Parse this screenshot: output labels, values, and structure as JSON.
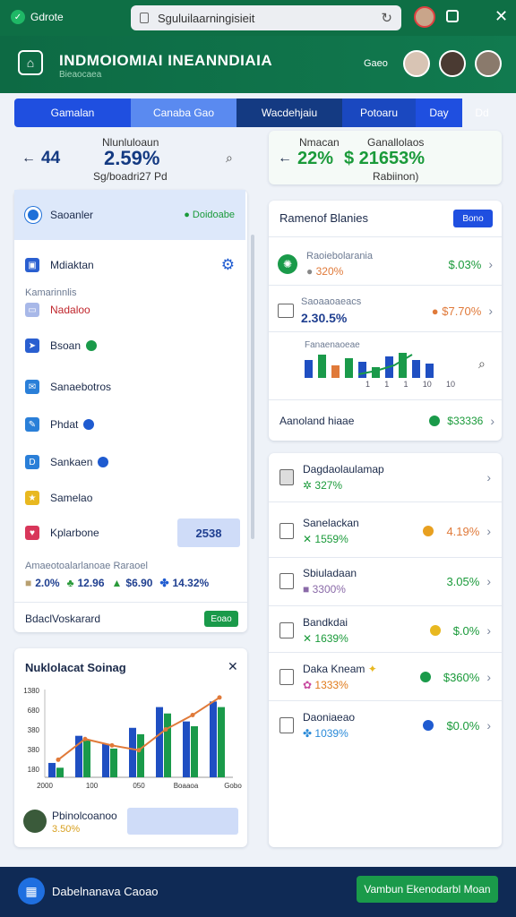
{
  "browser": {
    "tab_label": "Gdrote",
    "url": "Sguluilaarningisieit",
    "reload_icon": "reload-icon",
    "extension_icon": "extension-icon",
    "close_icon": "close-icon"
  },
  "header": {
    "title": "INDMOIOMIAI INEANNDIAIA",
    "subtitle": "Bieaocaea",
    "user_name": "Gaeo"
  },
  "tabs": [
    {
      "label": "Gamalan"
    },
    {
      "label": "Canaba Gao"
    },
    {
      "label": "Wacdehjaiu"
    },
    {
      "label": "Potoaru"
    },
    {
      "label": "Day"
    },
    {
      "label": "Dd"
    }
  ],
  "left_summary": {
    "label": "Nlunluloaun",
    "count": "44",
    "value": "2.59%",
    "sub": "Sg/boadri27 Pd"
  },
  "right_summary": {
    "label1": "Nmacan",
    "label2": "Ganallolaos",
    "value1": "22%",
    "value2": "$ 21653%",
    "sub": "Rabiinon)"
  },
  "sidebar": {
    "items": [
      {
        "label": "Saoanler",
        "badge": "Doidoabe"
      },
      {
        "label": "Mdiaktan"
      },
      {
        "label": "Nadaloo",
        "section": "Kamarinnlis"
      },
      {
        "label": "Bsoan"
      },
      {
        "label": "Sanaebotros"
      },
      {
        "label": "Phdat"
      },
      {
        "label": "Sankaen"
      },
      {
        "label": "Samelao"
      },
      {
        "label": "Kplarbone",
        "value": "2538"
      }
    ],
    "stats_header": "Amaeotoalarlanoae Raraoel",
    "stats": [
      "2.0%",
      "12.96",
      "$6.90",
      "14.32%"
    ],
    "footer_label": "BdaclVoskarard",
    "footer_button": "Eoao"
  },
  "chart_card": {
    "title": "Nuklolacat Soinag",
    "y_ticks": [
      "1380",
      "680",
      "380",
      "380",
      "180"
    ],
    "x_ticks": [
      "2000",
      "100",
      "050",
      "Boaaoa",
      "Gobo"
    ],
    "user_name": "Pbinolcoanoo",
    "user_value": "3.50%"
  },
  "chart_data": {
    "type": "bar",
    "x": [
      "2000",
      "100",
      "050",
      "Boaaoa",
      "Gobo"
    ],
    "ylabels": [
      "1380",
      "680",
      "380",
      "380",
      "180"
    ],
    "series": [
      {
        "values": [
          18,
          52,
          42,
          62,
          88,
          70,
          95
        ]
      },
      {
        "values": [
          12,
          46,
          36,
          54,
          80,
          64,
          88
        ]
      },
      {
        "values": [
          22,
          48,
          40,
          34,
          60,
          78,
          100
        ]
      }
    ],
    "series_colors": [
      "#1f4fc2",
      "#1a9a4a",
      "#e07a3a"
    ],
    "ylim": [
      0,
      110
    ]
  },
  "right_top": {
    "title": "Ramenof Blanies",
    "button": "Bono",
    "rows": [
      {
        "label": "Raoiebolarania",
        "sub": "320%",
        "value": "$.03%"
      },
      {
        "label": "Saoaaoaeacs",
        "value": "2.30.5%",
        "value2": "$7.70%"
      },
      {
        "label": "Fanaenaoeae"
      }
    ],
    "footer_label": "Aanoland hiaae",
    "footer_value": "$33336",
    "mini_ticks": [
      "1",
      "1",
      "1",
      "10",
      "10"
    ]
  },
  "right_list": [
    {
      "label": "Dagdaolaulamap",
      "sub": "327%"
    },
    {
      "label": "Sanelackan",
      "sub": "1559%",
      "value": "4.19%"
    },
    {
      "label": "Sbiuladaan",
      "sub": "3300%",
      "value": "3.05%"
    },
    {
      "label": "Bandkdai",
      "sub": "1639%",
      "value": "$.0%"
    },
    {
      "label": "Daka Kneam",
      "sub": "1333%",
      "value": "$360%"
    },
    {
      "label": "Daoniaeao",
      "sub": "1039%",
      "value": "$0.0%"
    }
  ],
  "bottom_bar": {
    "left_label": "Dabelnanava Caoao",
    "right_button": "Vambun Ekenodarbl Moan"
  },
  "colors": {
    "brand_green": "#0f7148",
    "accent_blue": "#1f4fe0",
    "navy": "#143a82",
    "bottom_navy": "#0f2a55"
  }
}
